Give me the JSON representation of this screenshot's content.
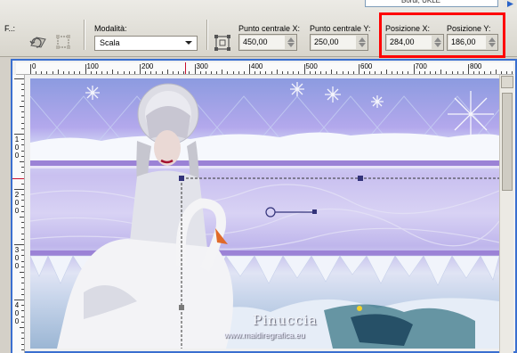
{
  "toolbar": {
    "top_combo_value": "Bordi, UKLE",
    "truncated_label": "F..:",
    "mode_label": "Modalità:",
    "mode_value": "Scala",
    "center_x_label": "Punto centrale X:",
    "center_x_value": "450,00",
    "center_y_label": "Punto centrale Y:",
    "center_y_value": "250,00",
    "pos_x_label": "Posizione X:",
    "pos_x_value": "284,00",
    "pos_y_label": "Posizione Y:",
    "pos_y_value": "186,00",
    "highlight_color": "#ff0000"
  },
  "ruler": {
    "h_labels": [
      "0",
      "100",
      "200",
      "300",
      "400",
      "500",
      "600",
      "700",
      "800"
    ],
    "v_labels": [
      "1 0 0",
      "2 0 0",
      "3 0 0",
      "4 0 0"
    ]
  },
  "canvas": {
    "watermark_name": "Pinuccia",
    "watermark_url": "www.maidiregrafica.eu",
    "accent_purple": "#9b82d6",
    "handle_color": "#33337a"
  },
  "icons": {
    "reset": "reset-deform-icon",
    "apply": "apply-deform-icon",
    "center": "center-point-icon",
    "nav": "arrow-right-icon"
  },
  "colors": {
    "frame_blue": "#3a6fd0",
    "toolbar_bg": "#d8d5cc"
  }
}
